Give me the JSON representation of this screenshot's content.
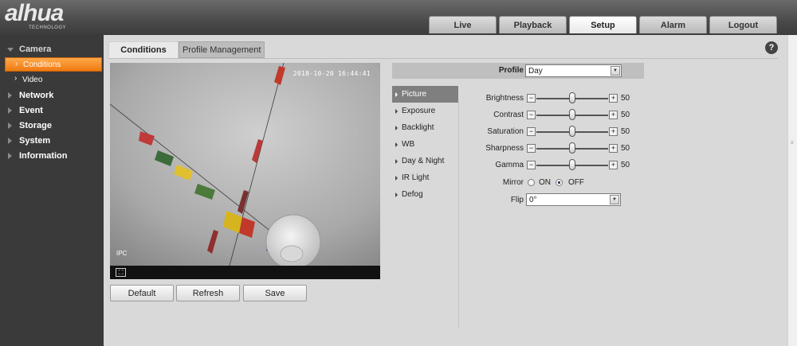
{
  "header": {
    "logo_text": "alhua",
    "logo_sub": "TECHNOLOGY",
    "nav": [
      "Live",
      "Playback",
      "Setup",
      "Alarm",
      "Logout"
    ],
    "active_nav": "Setup"
  },
  "sidebar": {
    "camera": "Camera",
    "conditions": "Conditions",
    "video": "Video",
    "network": "Network",
    "event": "Event",
    "storage": "Storage",
    "system": "System",
    "information": "Information"
  },
  "tabs": {
    "conditions": "Conditions",
    "profile_management": "Profile Management",
    "help": "?"
  },
  "video": {
    "timestamp": "2018-10-20 16:44:41",
    "camera_label": "IPC"
  },
  "buttons": {
    "default": "Default",
    "refresh": "Refresh",
    "save": "Save"
  },
  "profile": {
    "label": "Profile",
    "value": "Day"
  },
  "submenu": [
    "Picture",
    "Exposure",
    "Backlight",
    "WB",
    "Day & Night",
    "IR Light",
    "Defog"
  ],
  "submenu_active": "Picture",
  "picture": {
    "brightness": {
      "label": "Brightness",
      "value": "50"
    },
    "contrast": {
      "label": "Contrast",
      "value": "50"
    },
    "saturation": {
      "label": "Saturation",
      "value": "50"
    },
    "sharpness": {
      "label": "Sharpness",
      "value": "50"
    },
    "gamma": {
      "label": "Gamma",
      "value": "50"
    },
    "slider_min": "−",
    "slider_plus": "+",
    "mirror_label": "Mirror",
    "mirror_on": "ON",
    "mirror_off": "OFF",
    "mirror_value": "OFF",
    "flip_label": "Flip",
    "flip_value": "0°"
  },
  "colors": {
    "accent_orange": "#f07a10",
    "header_dark": "#4a4a4a",
    "sidebar": "#3a3a3a",
    "panel": "#d9d9d9"
  }
}
